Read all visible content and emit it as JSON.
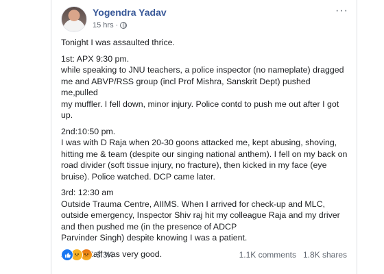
{
  "post": {
    "author": "Yogendra Yadav",
    "time": "15 hrs",
    "separator": "·",
    "more_icon": "···",
    "paragraphs": [
      {
        "lines": [
          "Tonight I was assaulted thrice."
        ]
      },
      {
        "lines": [
          "1st: APX 9:30 pm.",
          "while speaking to JNU teachers, a police inspector (no nameplate) dragged",
          "me and ABVP/RSS group (incl Prof Mishra, Sanskrit Dept) pushed me,pulled",
          "my muffler. I fell down, minor injury. Police contd to push me out after I got",
          "up."
        ]
      },
      {
        "lines": [
          "2nd:10:50 pm.",
          "I was with D Raja when 20-30 goons attacked me, kept abusing, shoving,",
          "hitting me & team (despite our singing national anthem). I fell on my back on",
          "road divider (soft tissue injury, no fracture), then kicked in my face (eye",
          "bruise). Police watched. DCP came later."
        ]
      },
      {
        "lines": [
          "3rd: 12:30 am",
          "Outside Trauma Centre, AIIMS. When I arrived for check-up and MLC,",
          "outside emergency, Inspector Shiv raj hit my colleague Raja and my driver",
          "and then pushed me (in the presence of ADCP",
          "Parvinder Singh) despite knowing I was a patient."
        ]
      },
      {
        "lines": [
          "AIIMS staff was very good."
        ]
      }
    ]
  },
  "footer": {
    "reaction_count": "8.3K",
    "comments": "1.1K comments",
    "shares": "1.8K shares",
    "reactions": [
      "like-icon",
      "sad-icon",
      "angry-icon"
    ]
  },
  "colors": {
    "author": "#385898",
    "meta": "#606770",
    "text": "#1c1e21",
    "like": "#1877f2"
  }
}
